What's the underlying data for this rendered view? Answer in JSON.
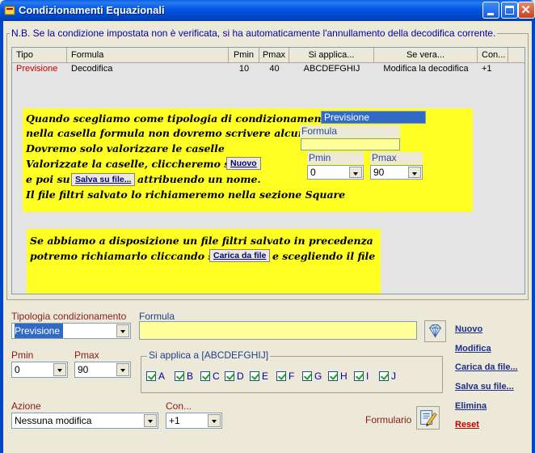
{
  "window": {
    "title": "Condizionamenti Equazionali"
  },
  "note": "N.B. Se la condizione impostata non è verificata, si ha automaticamente l'annullamento della decodifica corrente.",
  "grid": {
    "columns": [
      "Tipo",
      "Formula",
      "Pmin",
      "Pmax",
      "Si applica...",
      "Se vera...",
      "Con..."
    ],
    "rows": [
      [
        "Previsione",
        "Decodifica",
        "10",
        "40",
        "ABCDEFGHIJ",
        "Modifica la decodifica",
        "+1"
      ]
    ]
  },
  "help1": {
    "line1": "Quando scegliamo come tipologia di condizionamento",
    "line2": "nella casella formula non dovremo scrivere alcunchè.",
    "line3": "Dovremo solo valorizzare le caselle",
    "line4": "Valorizzate la caselle, cliccheremo su",
    "line5a": "e poi su",
    "line5b": "attribuendo un nome.",
    "line6": "Il file filtri salvato lo richiameremo nella sezione Square",
    "btn_nuovo": "Nuovo",
    "btn_salva": "Salva su file...",
    "sel_tipo": "Previsione",
    "lbl_formula": "Formula",
    "lbl_pmin": "Pmin",
    "lbl_pmax": "Pmax",
    "val_pmin": "0",
    "val_pmax": "90"
  },
  "help2": {
    "line1": "Se abbiamo a disposizione un file filtri salvato in precedenza",
    "line2a": "potremo richiamarlo  cliccando su",
    "line2b": "e scegliendo il file",
    "btn_carica": "Carica da file"
  },
  "form": {
    "tipologia_label": "Tipologia condizionamento",
    "tipologia_value": "Previsione",
    "formula_label": "Formula",
    "formula_value": "",
    "pmin_label": "Pmin",
    "pmin_value": "0",
    "pmax_label": "Pmax",
    "pmax_value": "90",
    "applica_label": "Si applica a [ABCDEFGHIJ]",
    "checkboxes": [
      "A",
      "B",
      "C",
      "D",
      "E",
      "F",
      "G",
      "H",
      "I",
      "J"
    ],
    "azione_label": "Azione",
    "azione_value": "Nessuna modifica",
    "con_label": "Con...",
    "con_value": "+1",
    "formulario_label": "Formulario"
  },
  "actions": {
    "nuovo": "Nuovo",
    "modifica": "Modifica",
    "carica": "Carica da file...",
    "salva": "Salva su file...",
    "elimina": "Elimina",
    "reset": "Reset"
  },
  "colors": {
    "titlebar": "#0055E5",
    "note_text": "#0000A8",
    "help_bg": "#FFFF24",
    "field_bg": "#FFFF99",
    "reset": "#C00000"
  }
}
